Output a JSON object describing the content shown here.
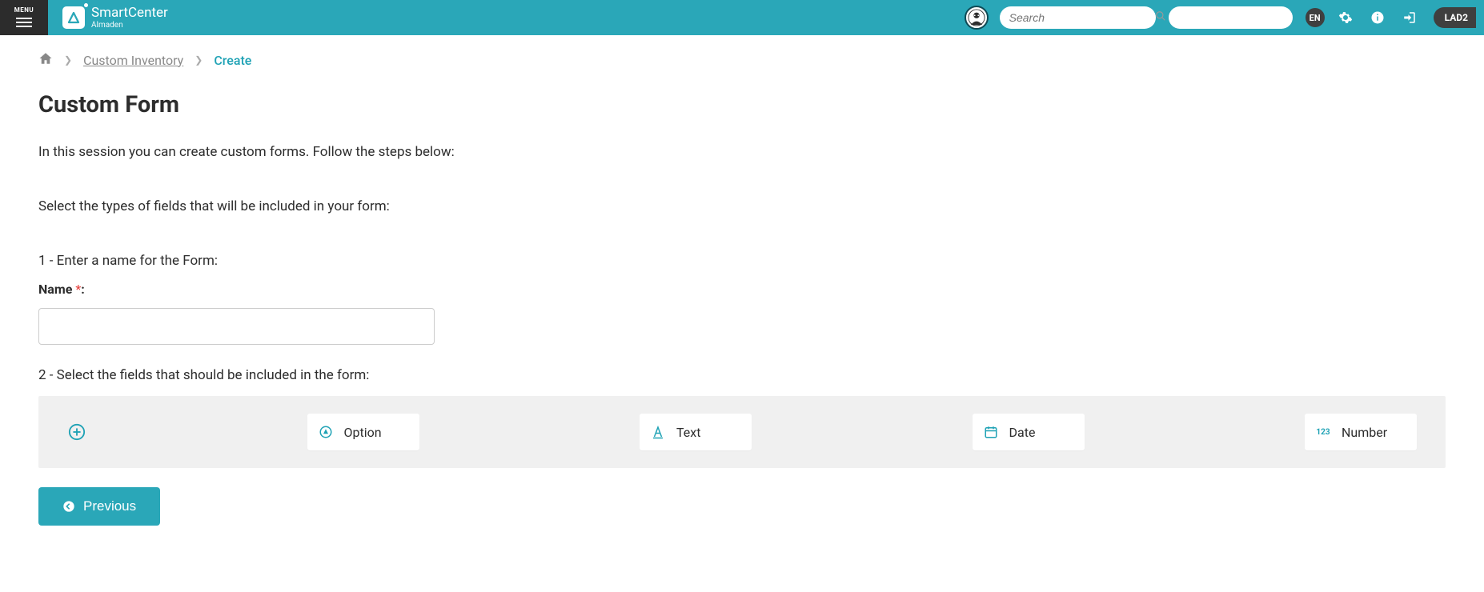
{
  "header": {
    "menu_label": "MENU",
    "brand_title": "SmartCenter",
    "brand_sub": "Almaden",
    "search_placeholder": "Search",
    "lang_badge": "EN",
    "env_label": "LAD2"
  },
  "breadcrumb": {
    "item1": "Custom Inventory",
    "item2": "Create"
  },
  "page": {
    "title": "Custom Form",
    "intro": "In this session you can create custom forms. Follow the steps below:",
    "select_types": "Select the types of fields that will be included in your form:",
    "step1": "1 - Enter a name for the Form:",
    "name_label": "Name ",
    "name_colon": ":",
    "step2": "2 - Select the fields that should be included in the form:"
  },
  "field_types": {
    "option": "Option",
    "text": "Text",
    "date": "Date",
    "number": "Number",
    "num_icon": "123"
  },
  "buttons": {
    "previous": "Previous"
  },
  "colors": {
    "brand": "#2aa7b8",
    "accent": "#1fa2b5"
  }
}
